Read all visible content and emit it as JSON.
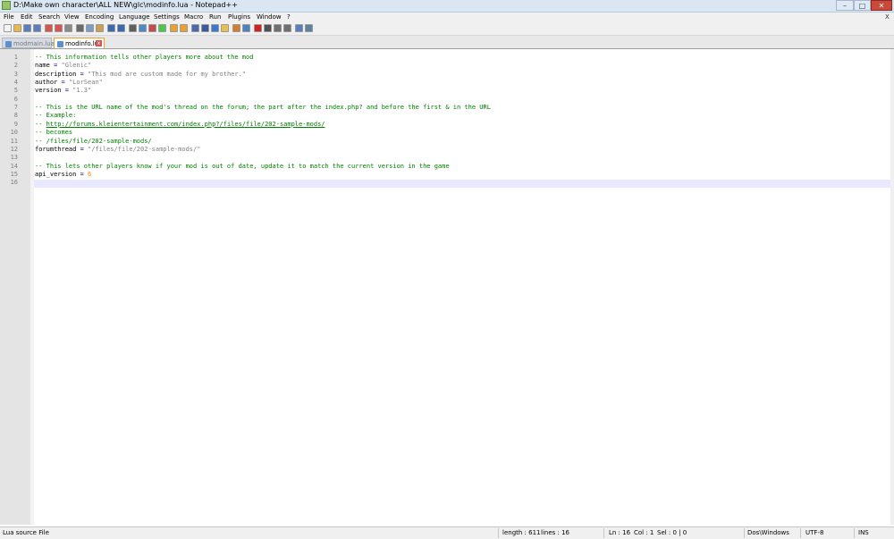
{
  "window": {
    "title": "D:\\Make own character\\ALL NEW\\glc\\modinfo.lua - Notepad++",
    "minimize_glyph": "–",
    "maximize_glyph": "□",
    "close_glyph": "✕"
  },
  "menu": {
    "items": [
      "File",
      "Edit",
      "Search",
      "View",
      "Encoding",
      "Language",
      "Settings",
      "Macro",
      "Run",
      "Plugins",
      "Window",
      "?"
    ],
    "close_doc": "X"
  },
  "toolbar": {
    "buttons": [
      {
        "icon": "new-file-icon",
        "color": "#f4f4f4"
      },
      {
        "icon": "open-folder-icon",
        "color": "#e8b94a"
      },
      {
        "icon": "save-icon",
        "color": "#5a7fbf"
      },
      {
        "icon": "save-all-icon",
        "color": "#5a7fbf"
      },
      {
        "icon": "close-icon",
        "color": "#d9534f"
      },
      {
        "icon": "close-all-icon",
        "color": "#d9534f"
      },
      {
        "icon": "print-icon",
        "color": "#8a8a8a"
      },
      {
        "icon": "cut-icon",
        "color": "#6a6a6a"
      },
      {
        "icon": "copy-icon",
        "color": "#7a9cc6"
      },
      {
        "icon": "paste-icon",
        "color": "#c8a050"
      },
      {
        "icon": "undo-icon",
        "color": "#3a6ab0"
      },
      {
        "icon": "redo-icon",
        "color": "#3a6ab0"
      },
      {
        "icon": "find-icon",
        "color": "#606060"
      },
      {
        "icon": "replace-icon",
        "color": "#4a8ac8"
      },
      {
        "icon": "zoom-in-icon",
        "color": "#c84a4a"
      },
      {
        "icon": "zoom-out-icon",
        "color": "#4ac84a"
      },
      {
        "icon": "sync-vertical-icon",
        "color": "#e8a030"
      },
      {
        "icon": "sync-horizontal-icon",
        "color": "#e8a030"
      },
      {
        "icon": "word-wrap-icon",
        "color": "#4a6ab0"
      },
      {
        "icon": "show-all-chars-icon",
        "color": "#3a5aa0"
      },
      {
        "icon": "indent-guide-icon",
        "color": "#3a7ad0"
      },
      {
        "icon": "user-language-icon",
        "color": "#e8c050"
      },
      {
        "icon": "doc-map-icon",
        "color": "#d08030"
      },
      {
        "icon": "function-list-icon",
        "color": "#5080c0"
      },
      {
        "icon": "record-macro-icon",
        "color": "#d02020"
      },
      {
        "icon": "stop-macro-icon",
        "color": "#505050"
      },
      {
        "icon": "play-macro-icon",
        "color": "#707070"
      },
      {
        "icon": "run-macro-multiple-icon",
        "color": "#707070"
      },
      {
        "icon": "save-macro-icon",
        "color": "#5a7fbf"
      },
      {
        "icon": "spell-check-icon",
        "color": "#6080a0"
      }
    ]
  },
  "tabs": [
    {
      "label": "modmain.lua",
      "active": false,
      "icon_color": "#5a8fd0"
    },
    {
      "label": "modinfo.lua",
      "active": true,
      "icon_color": "#5a8fd0",
      "close_glyph": "x"
    }
  ],
  "editor": {
    "line_numbers": [
      "1",
      "2",
      "3",
      "4",
      "5",
      "6",
      "7",
      "8",
      "9",
      "10",
      "11",
      "12",
      "13",
      "14",
      "15",
      "16"
    ],
    "lines": [
      [
        {
          "t": "-- This information tells other players more about the mod",
          "c": "cm"
        }
      ],
      [
        {
          "t": "name ",
          "c": ""
        },
        {
          "t": "=",
          "c": "op"
        },
        {
          "t": " ",
          "c": ""
        },
        {
          "t": "\"Glenic\"",
          "c": "str"
        }
      ],
      [
        {
          "t": "description ",
          "c": ""
        },
        {
          "t": "=",
          "c": "op"
        },
        {
          "t": " ",
          "c": ""
        },
        {
          "t": "\"This mod are custom made for my brother.\"",
          "c": "str"
        }
      ],
      [
        {
          "t": "author ",
          "c": ""
        },
        {
          "t": "=",
          "c": "op"
        },
        {
          "t": " ",
          "c": ""
        },
        {
          "t": "\"LorSean\"",
          "c": "str"
        }
      ],
      [
        {
          "t": "version ",
          "c": ""
        },
        {
          "t": "=",
          "c": "op"
        },
        {
          "t": " ",
          "c": ""
        },
        {
          "t": "\"1.3\"",
          "c": "str"
        }
      ],
      [],
      [
        {
          "t": "-- This is the URL name of the mod's thread on the forum; the part after the index.php? and before the first & in the URL",
          "c": "cm"
        }
      ],
      [
        {
          "t": "-- Example:",
          "c": "cm"
        }
      ],
      [
        {
          "t": "-- ",
          "c": "cm"
        },
        {
          "t": "http://forums.kleientertainment.com/index.php?/files/file/202-sample-mods/",
          "c": "cm-link"
        }
      ],
      [
        {
          "t": "-- becomes",
          "c": "cm"
        }
      ],
      [
        {
          "t": "-- /files/file/202-sample-mods/",
          "c": "cm"
        }
      ],
      [
        {
          "t": "forumthread ",
          "c": ""
        },
        {
          "t": "=",
          "c": "op"
        },
        {
          "t": " ",
          "c": ""
        },
        {
          "t": "\"/files/file/202-sample-mods/\"",
          "c": "str"
        }
      ],
      [],
      [
        {
          "t": "-- This lets other players know if your mod is out of date, update it to match the current version in the game",
          "c": "cm"
        }
      ],
      [
        {
          "t": "api_version ",
          "c": ""
        },
        {
          "t": "=",
          "c": "op"
        },
        {
          "t": " ",
          "c": ""
        },
        {
          "t": "6",
          "c": "num"
        }
      ],
      []
    ]
  },
  "status": {
    "file_type": "Lua source File",
    "length": "length : 611",
    "lines": "lines : 16",
    "ln": "Ln : 16",
    "col": "Col : 1",
    "sel": "Sel : 0 | 0",
    "eol": "Dos\\Windows",
    "encoding": "UTF-8",
    "mode": "INS"
  }
}
